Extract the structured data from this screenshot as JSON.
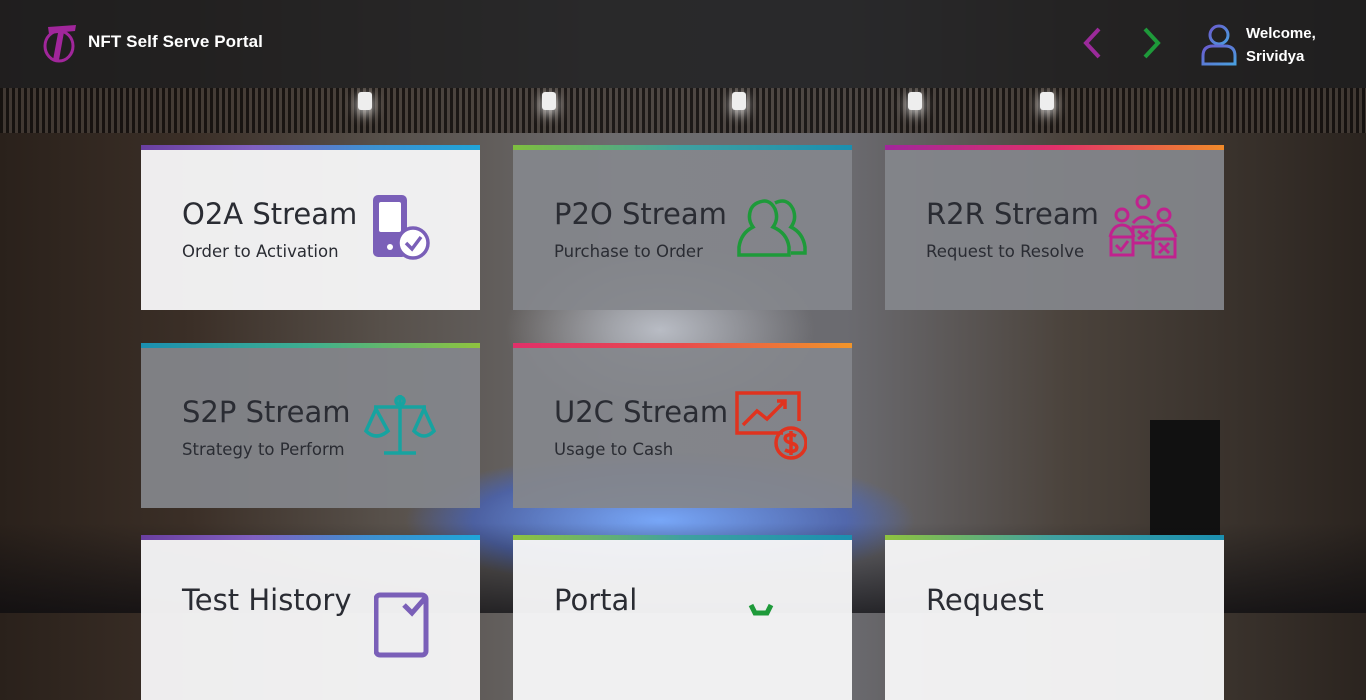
{
  "header": {
    "title": "NFT Self Serve Portal",
    "welcome_line1": "Welcome,",
    "welcome_line2": "Srividya"
  },
  "colors": {
    "brand_purple": "#a1269b",
    "nav_prev": "#9b2a9a",
    "nav_next": "#1e9a3a",
    "tile_gray": "#84868c",
    "tile_light": "#f6f6f7"
  },
  "tiles": [
    {
      "title": "O2A Stream",
      "subtitle": "Order to Activation",
      "icon": "mobile-check-icon"
    },
    {
      "title": "P2O Stream",
      "subtitle": "Purchase to Order",
      "icon": "users-icon"
    },
    {
      "title": "R2R Stream",
      "subtitle": "Request to Resolve",
      "icon": "team-tasks-icon"
    },
    {
      "title": "S2P Stream",
      "subtitle": "Strategy to Perform",
      "icon": "scales-icon"
    },
    {
      "title": "U2C Stream",
      "subtitle": "Usage to Cash",
      "icon": "growth-dollar-icon"
    },
    {
      "title": "Test History",
      "subtitle": "",
      "icon": "checklist-icon"
    },
    {
      "title": "Portal",
      "subtitle": "",
      "icon": "portal-icon"
    },
    {
      "title": "Request",
      "subtitle": "",
      "icon": "request-icon"
    }
  ]
}
